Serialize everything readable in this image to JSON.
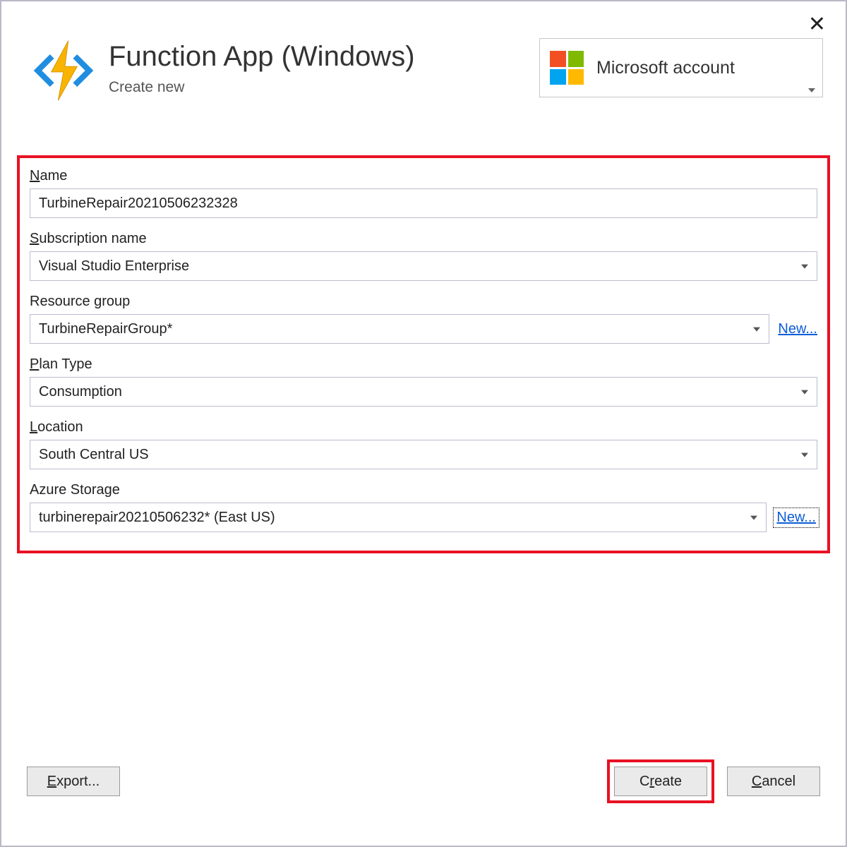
{
  "header": {
    "title": "Function App (Windows)",
    "subtitle": "Create new",
    "account_label": "Microsoft account"
  },
  "form": {
    "name_label": "Name",
    "name_value": "TurbineRepair20210506232328",
    "subscription_label": "Subscription name",
    "subscription_value": "Visual Studio Enterprise",
    "resourcegroup_label": "Resource group",
    "resourcegroup_value": "TurbineRepairGroup*",
    "resourcegroup_new": "New...",
    "plantype_label": "Plan Type",
    "plantype_value": "Consumption",
    "location_label": "Location",
    "location_value": "South Central US",
    "storage_label": "Azure Storage",
    "storage_value": "turbinerepair20210506232* (East US)",
    "storage_new": "New..."
  },
  "footer": {
    "export_label": "Export...",
    "create_label": "Create",
    "cancel_label": "Cancel"
  }
}
